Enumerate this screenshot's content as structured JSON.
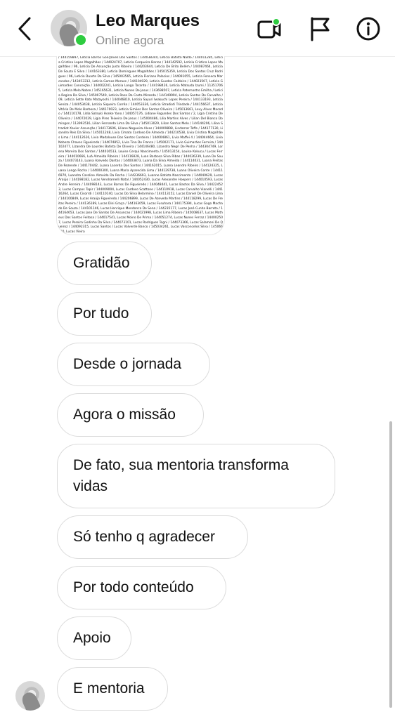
{
  "header": {
    "name": "Leo Marques",
    "status": "Online agora",
    "icons": {
      "back": "chevron-left-icon",
      "video": "video-call-icon",
      "flag": "flag-icon",
      "info": "info-icon"
    },
    "accent_online": "#2ecc40"
  },
  "shared_image": {
    "text": "/ 144159897, Leticia Barros Gonçalves Dos Santos / 144038344, Leticia Batista Naldo / 144011285, Leticia Cristina Lopes Magalhães / 144024707, Leticia Cerqueira Barros / 144142592, Leticia Cristina Lopes Magalhães / 96, Leticia De Assunção Justo Ribeiro / 144203644, Leticia De Brito Belém / 144087464, Leticia De Souza E Silva / 144163380, Leticia Domingues Magalhães / 145015359, Leticia Dos Santos Cruz Rodrigues / 96, Leticia Duarte Da Silva / 145003565, Leticia Floriano Palacios / 144091055, Leticia Fonseca Marcondes / 143453312, Leticia Gomes Moraes / 144104929, Leticia Guedes Caldeira / 144023507, Leticia Guimarães Conceição / 144002241, Leticia Longo Taranto / 144198426, Leticia Matsuda Izumi / 113517065, Leticia Melo Nobre / 145165631, Leticia Nunes De Jesus / 143698507, Leticia Paternostro Emilha / Leticia Regina Da Silva / 145007549, Leticia Rosa Da Costa Miranda / 144149994, Leticia Santos De Carvalho / 09, Leticia Sette Kato Matayoshi / 144046810, Leticia Sayuri Iwakuchi Lopes Pereira / 144133193, Leticia Seniza / 144053438, Leticia Siqueira Corrêa / 144053336, Leticia Stradioti Trindade / 144156637, Leticia Vitória De Melo Barbosa / 144170023, Leticia Simões Dos Santos Oliveira / 145013661, Levy Alves Macedo / 144110178, Lídia Satsuki Honke Yano / 144057176, Lidiane Fagundes Dos Santos / 2, Ligia Cristina De Oliveira / 144072029, Ligia Pires Teixeira De Jesus / 145004486, Lilia Martins Alves / Lilian Del Bianco Domingos / 113993516, Lilian Fernanda Lima Da Silva / 145013029, Lilian Santos Melo / 144144206, Lilian Stradiot Xavier Assunção / 144173606, Liliane Nogueira Alves / 144009898, Lindamar Taffe / 144177130, Lisandro Reis Da Silva / 145011248, Livia Cimato Cardoso De Almeida / 144210538, Livia Cristina Magalhães Lima / 144112626, Livia Madalouse Dos Santos Cordeiro / 144004861, Livia Maffei 4 / 144044664, Livia Nebeza Chaves Figueiredo / 144074852, Livia Tina De Franca / 145002171, Livio Guimarães Ferreira / 144102477, Lizandra De Lourdes Batista De Oliveira / 144146480, Lizandra Negri De Penha / 144304749, Lorena Moreira Dos Santos / 144016513, Louise Cerqui Nascimento / 145013154, Louise Kokucu / Lucas Ferreira / 144010666, Luã Almeida Ribeiro / 144116828, Luan Barbosa Silva Ribas / 144026239, Luan De Souza / 144073143, Luana Azevedo Dantas / 144003873, Luana Da Silva Almeida / 144114031, Luana Freitas De Rezende / 144170442, Luana Lacerda Dos Santos / 144162015, Luana Leandro Ribeiro / 144124325, Luana Longo Rocha / 144000300, Luana Maria Aparecida Lima / 144129738, Luana Oliveira Conte / 144116970, Luandra Caroline Almeida Da Rocha / 144236693, Luanne Batista Nascimento / 144040629, Lucas Araújo / 144198182, Lucas Vendramelli Natal / 144052430, Lucas Alexandre Hoepers / 144010593, Lucas Andre Ferreira / 144098143, Lucas Barros De Figueiredo / 144048441, Lucas Bastos Da Silva / 144224523, Lucas Campos Tapir / 144009004, Lucas Cardoso Scattone / 144110918, Lucas Carvalho Vianelli / 144116264, Lucas Cisorrdi / 144110140, Lucas Do Silva Belarmino / 144113152, Lucas Daniel De Oliveira Lima / 144100849, Lucas Araújo Figueiredo / 144206899, Lucas De Azevedo Martins / 144118299, Lucas De Freitas Pereira / 144136189, Lucas Dini Graça / 144163059, Lucas Fusuhara / 144175394, Lucas Gago Machado De Souza / 144101146, Lucas Henrique Mendonca De Sena / 144235177, Lucas José Cunha Barreto / 144164653, Lucas Jose De Santos De Assuncao / 144021998, Lucas Lima Ribeiro / 145008637, Lucas Matheus Dos Santos Feitosa / 144017541, Lucas Moino De Prima / 144051274, Lucas Nunes Ferraz / 144002507, Lucas Pereira Godinho Da Silva / 144073101, Lucas Rodrigues Togni / 144073366, Lucas Salamoni De Queiroz / 144092315, Lucas Santos / Lucas Valverde Banco / 145034261, Lucas Vasconcelos Silva / 145066330, Lucas Vieira"
  },
  "messages": [
    {
      "text": "Gratidão"
    },
    {
      "text": "Por tudo"
    },
    {
      "text": "Desde o jornada"
    },
    {
      "text": "Agora o missão"
    },
    {
      "text": "De fato, sua mentoria transforma vidas"
    },
    {
      "text": "Só tenho q agradecer"
    },
    {
      "text": "Por todo conteúdo"
    },
    {
      "text": "Apoio"
    },
    {
      "text": "E mentoria"
    }
  ]
}
